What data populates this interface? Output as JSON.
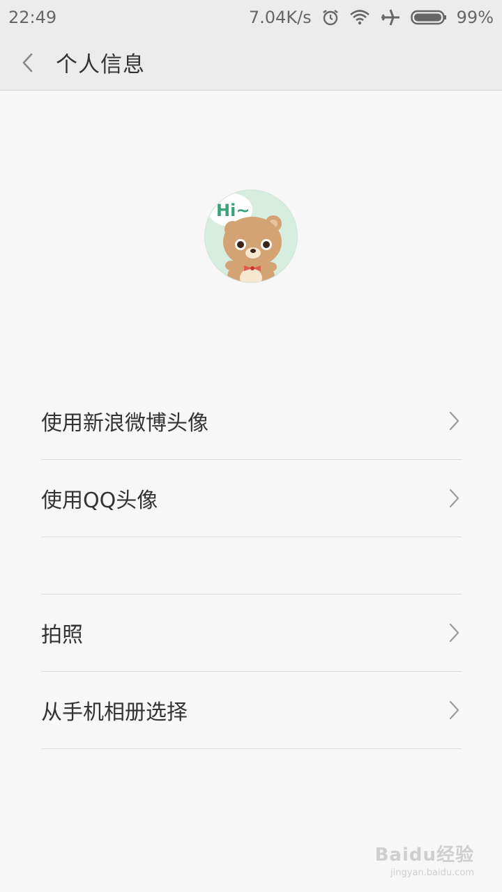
{
  "status_bar": {
    "time": "22:49",
    "speed": "7.04K/s",
    "battery": "99%",
    "icons": [
      "alarm-icon",
      "wifi-icon",
      "airplane-icon",
      "battery-icon"
    ]
  },
  "app_bar": {
    "title": "个人信息",
    "back_icon": "chevron-left-icon"
  },
  "avatar": {
    "bubble_text": "Hi~"
  },
  "menu": {
    "group1": [
      {
        "label": "使用新浪微博头像"
      },
      {
        "label": "使用QQ头像"
      }
    ],
    "group2": [
      {
        "label": "拍照"
      },
      {
        "label": "从手机相册选择"
      }
    ]
  },
  "watermark": {
    "main": "Baidu经验",
    "sub": "jingyan.baidu.com"
  },
  "colors": {
    "background": "#f7f7f7",
    "bar": "#ececec",
    "divider": "#dcdcdc",
    "avatar_bg": "#d7eddf",
    "bubble_text": "#3aa27a"
  }
}
